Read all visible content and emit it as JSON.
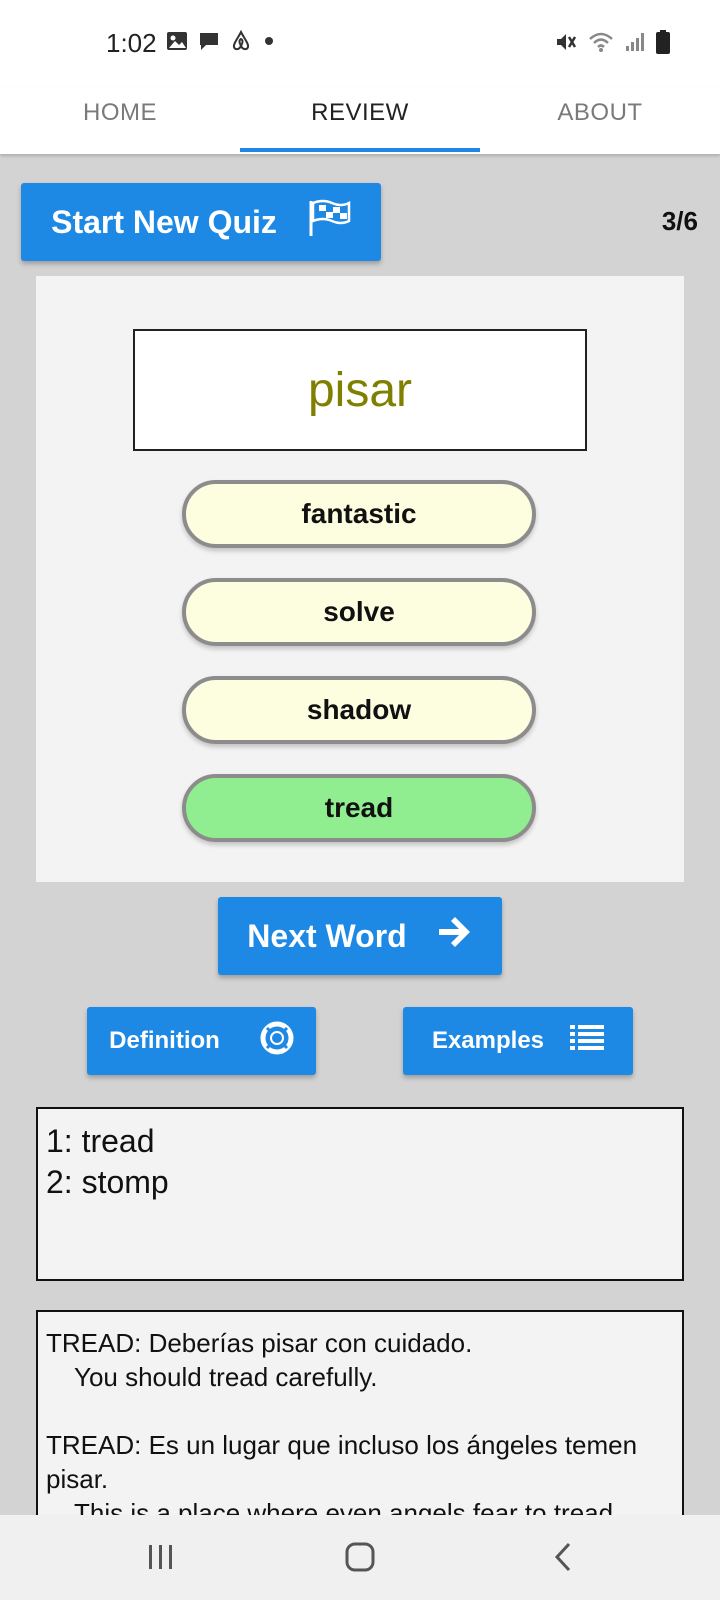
{
  "status": {
    "time": "1:02"
  },
  "tabs": [
    {
      "label": "HOME",
      "active": false
    },
    {
      "label": "REVIEW",
      "active": true
    },
    {
      "label": "ABOUT",
      "active": false
    }
  ],
  "quiz": {
    "start_label": "Start New Quiz",
    "counter": "3/6",
    "word": "pisar",
    "options": [
      {
        "label": "fantastic",
        "state": "default"
      },
      {
        "label": "solve",
        "state": "default"
      },
      {
        "label": "shadow",
        "state": "default"
      },
      {
        "label": "tread",
        "state": "correct"
      }
    ],
    "next_label": "Next Word",
    "definition_label": "Definition",
    "examples_label": "Examples"
  },
  "definitions": [
    "1: tread",
    "2: stomp"
  ],
  "examples": [
    {
      "spanish": "TREAD: Deberías pisar con cuidado.",
      "english": "You should tread carefully."
    },
    {
      "spanish": "TREAD: Es un lugar que incluso los ángeles temen pisar.",
      "english": "This is a place where even angels fear to tread."
    }
  ],
  "colors": {
    "accent": "#1e88e5",
    "word": "#808000",
    "option_bg": "#fdfde0",
    "option_correct": "#90ee90"
  },
  "icons": {
    "status_left": [
      "image-icon",
      "chat-icon",
      "airbnb-icon",
      "dot-icon"
    ],
    "status_right": [
      "mute-icon",
      "wifi-icon",
      "signal-icon",
      "battery-icon"
    ],
    "start_quiz": "flag-checkered-icon",
    "next_word": "arrow-right-icon",
    "definition": "lifebuoy-icon",
    "examples": "list-icon",
    "nav": [
      "recents-icon",
      "home-icon",
      "back-icon"
    ]
  }
}
